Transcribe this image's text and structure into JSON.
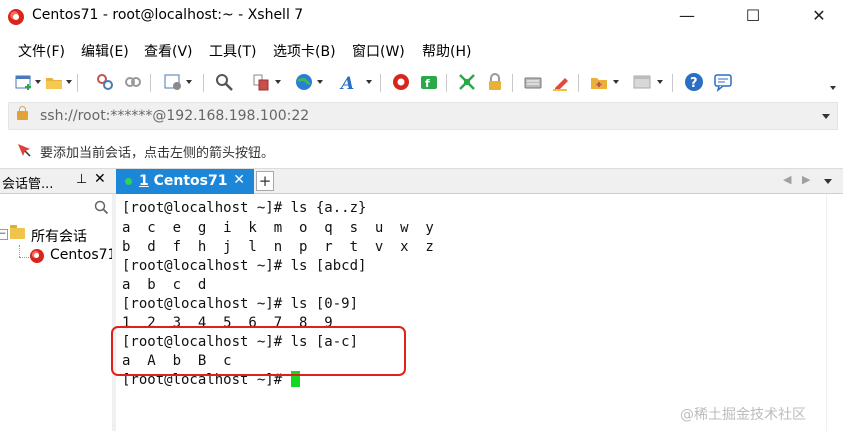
{
  "window": {
    "title": "Centos71 - root@localhost:~ - Xshell 7",
    "minimize": "—",
    "maximize": "☐",
    "close": "✕"
  },
  "menu": {
    "items": [
      "文件(F)",
      "编辑(E)",
      "查看(V)",
      "工具(T)",
      "选项卡(B)",
      "窗口(W)",
      "帮助(H)"
    ]
  },
  "toolbar": {
    "icons": [
      "new-session-icon",
      "open-folder-icon",
      "disconnect-icon",
      "reconnect-icon",
      "properties-icon",
      "find-icon",
      "copy-paste-icon",
      "globe-icon",
      "font-icon",
      "xshell-logo-icon",
      "xftp-icon",
      "fullscreen-icon",
      "lock-icon",
      "keyboard-icon",
      "highlighter-icon",
      "script-icon",
      "layout-icon",
      "help-icon",
      "chat-icon"
    ]
  },
  "address": {
    "value": "ssh://root:******@192.168.198.100:22"
  },
  "hint": {
    "text": "要添加当前会话，点击左侧的箭头按钮。"
  },
  "panel": {
    "title": "会话管...",
    "pin": "⊥",
    "close": "✕",
    "tree_root": "所有会话",
    "tree_expander": "−",
    "tree_child": "Centos71"
  },
  "tab": {
    "number": "1",
    "name": "Centos71",
    "close": "✕",
    "add": "+",
    "prev": "◀",
    "next": "▶"
  },
  "terminal": {
    "lines": [
      "[root@localhost ~]# ls {a..z}",
      "a  c  e  g  i  k  m  o  q  s  u  w  y",
      "b  d  f  h  j  l  n  p  r  t  v  x  z",
      "[root@localhost ~]# ls [abcd]",
      "a  b  c  d",
      "[root@localhost ~]# ls [0-9]",
      "1  2  3  4  5  6  7  8  9",
      "[root@localhost ~]# ls [a-c]",
      "a  A  b  B  c",
      "[root@localhost ~]# "
    ]
  },
  "watermark": "@稀土掘金技术社区",
  "colors": {
    "tab_active": "#1c86d8",
    "cursor": "#15d823",
    "highlight_box": "#e0201b"
  }
}
